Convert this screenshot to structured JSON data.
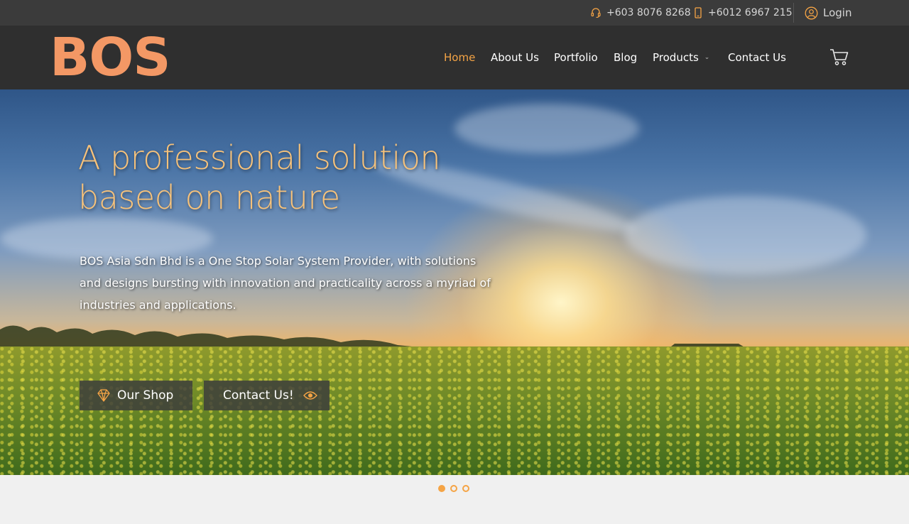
{
  "topbar": {
    "phone1": "+603 8076 8268",
    "phone2": "+6012 6967 215",
    "login": "Login"
  },
  "brand": {
    "logo_text": "BOS",
    "logo_color": "#f39865"
  },
  "nav": {
    "items": [
      "Home",
      "About Us",
      "Portfolio",
      "Blog",
      "Products",
      "Contact Us"
    ],
    "active_color": "#f5a445"
  },
  "hero": {
    "headline_line1": "A professional solution",
    "headline_line2": "based on nature",
    "description": "BOS Asia Sdn Bhd is a One Stop Solar System Provider, with solutions and designs bursting with innovation and practicality across a myriad of industries and applications.",
    "shop_button": "Our Shop",
    "contact_button": "Contact Us!"
  },
  "slider": {
    "slide_count": 3,
    "active_slide": 1
  },
  "icons": {
    "phone1": "headset-icon",
    "phone2": "mobile-phone-icon",
    "login": "user-circle-icon",
    "cart": "shopping-cart-icon",
    "shop": "diamond-icon",
    "contact": "eye-icon"
  }
}
